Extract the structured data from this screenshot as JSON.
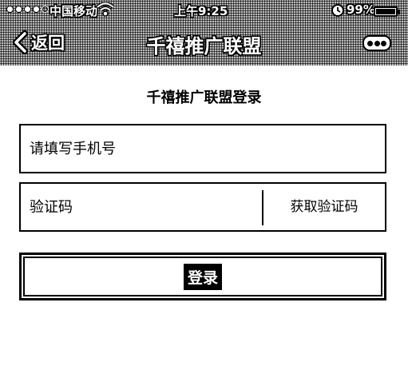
{
  "status_bar": {
    "carrier": "中国移动",
    "wifi_icon": "wifi-icon",
    "time": "上午9:25",
    "alarm_icon": "alarm-icon",
    "battery": "99%",
    "battery_level": 0.99
  },
  "nav": {
    "back_label": "返回",
    "title": "千禧推广联盟",
    "back_icon": "chevron-left-icon",
    "more_icon": "more-icon"
  },
  "page": {
    "title": "千禧推广联盟登录"
  },
  "form": {
    "phone_placeholder": "请填写手机号",
    "code_placeholder": "验证码",
    "get_code_label": "获取验证码",
    "login_label": "登录"
  }
}
